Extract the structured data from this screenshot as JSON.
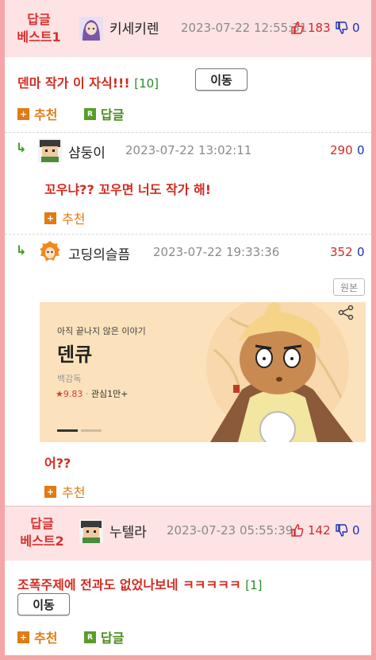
{
  "comments": [
    {
      "best_label_1": "답글",
      "best_label_2": "베스트1",
      "nickname": "키세키렌",
      "date": "2023-07-22 12:55:31",
      "up": "183",
      "down": "0",
      "body": "덴마 작가 이 자식!!!",
      "reply_count": "[10]",
      "move_label": "이동",
      "recommend_label": "추천",
      "reply_label": "답글"
    },
    {
      "nickname": "샴둥이",
      "date": "2023-07-22 13:02:11",
      "up": "290",
      "down": "0",
      "body": "꼬우냐?? 꼬우면 너도 작가 해!",
      "recommend_label": "추천"
    },
    {
      "nickname": "고딩의슬픔",
      "date": "2023-07-22 19:33:36",
      "up": "352",
      "down": "0",
      "original_label": "원본",
      "body": "어??",
      "recommend_label": "추천",
      "banner": {
        "subtitle": "아직 끝나지 않은 이야기",
        "title": "덴큐",
        "author": "백감독",
        "rating": "★9.83",
        "interest": "관심1만+"
      }
    },
    {
      "best_label_1": "답글",
      "best_label_2": "베스트2",
      "nickname": "누텔라",
      "date": "2023-07-23 05:55:39",
      "up": "142",
      "down": "0",
      "body": "조폭주제에 전과도 없었나보네 ㅋㅋㅋㅋㅋ",
      "reply_count": "[1]",
      "move_label": "이동",
      "recommend_label": "추천",
      "reply_label": "답글"
    }
  ],
  "icons": {
    "plus": "+",
    "reply_badge": "R",
    "reply_arrow": "↳"
  },
  "colors": {
    "best_bg": "#fde3e4",
    "frame": "#f4a6a8",
    "title_red": "#d42a1f",
    "recommend_orange": "#e07b16",
    "reply_green": "#4a8a1f",
    "up_red": "#d02a2a",
    "down_blue": "#1a2fb8"
  }
}
